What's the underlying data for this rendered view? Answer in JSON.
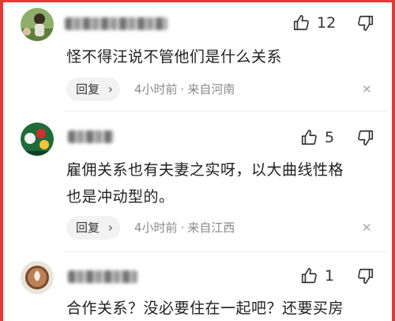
{
  "comments": [
    {
      "avatar": "garden-photo-avatar",
      "likes": "12",
      "text": "怪不得汪说不管他们是什么关系",
      "reply_label": "回复",
      "time": "4小时前",
      "location": "来自河南"
    },
    {
      "avatar": "billiards-photo-avatar",
      "likes": "5",
      "text_line1": "雇佣关系也有夫妻之实呀，以大曲线性格",
      "text_line2": "也是冲动型的。",
      "reply_label": "回复",
      "time": "4小时前",
      "location": "来自江西"
    },
    {
      "avatar": "coffee-latte-avatar",
      "likes": "1",
      "text": "合作关系？没必要住在一起吧？还要买房"
    }
  ],
  "icons": {
    "like": "thumb-up-icon",
    "dislike": "thumb-down-icon",
    "dismiss": "close-icon",
    "chevron": "chevron-right-icon"
  },
  "colors": {
    "frame": "#e53935",
    "meta": "#8a8a8a",
    "reply_bg": "#f2f2f2"
  }
}
